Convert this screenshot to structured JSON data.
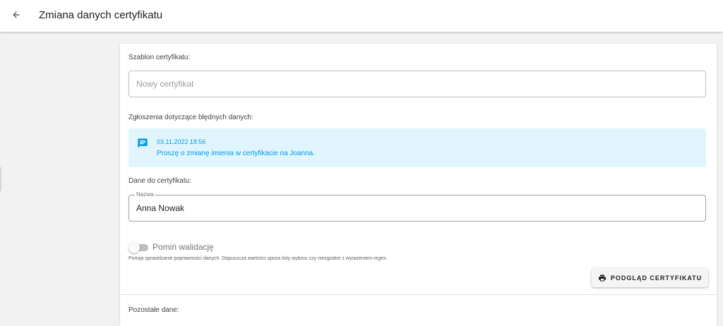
{
  "header": {
    "title": "Zmiana danych certyfikatu",
    "back_icon": "arrow-left-icon"
  },
  "template_section": {
    "label": "Szablon certyfikatu:",
    "placeholder": "Nowy certyfikat",
    "value": ""
  },
  "reports_section": {
    "label": "Zgłoszenia dotyczące błędnych danych:",
    "items": [
      {
        "icon": "comment-icon",
        "date": "03.11.2022 18:56",
        "text": "Proszę o zmianę imienia w certyfikacie na Joanna."
      }
    ]
  },
  "certificate_data_section": {
    "label": "Dane do certyfikatu:",
    "name_field": {
      "legend": "Nazwa",
      "value": "Anna Nowak"
    }
  },
  "skip_validation": {
    "label": "Pomiń walidację",
    "enabled": false,
    "hint": "Pomija sprawdzanie poprawności danych. Dopuszcza wartości spoza listy wyboru czy niezgodne z wyrażeniem regex."
  },
  "preview_button": {
    "label": "PODGLĄD CERTYFIKATU",
    "icon": "printer-icon"
  },
  "other_data_section": {
    "label": "Pozostałe dane:"
  },
  "colors": {
    "accent": "#039be5",
    "report_background": "#e1f5fe",
    "header_background": "#ffffff",
    "page_background": "#f2f2f2"
  }
}
